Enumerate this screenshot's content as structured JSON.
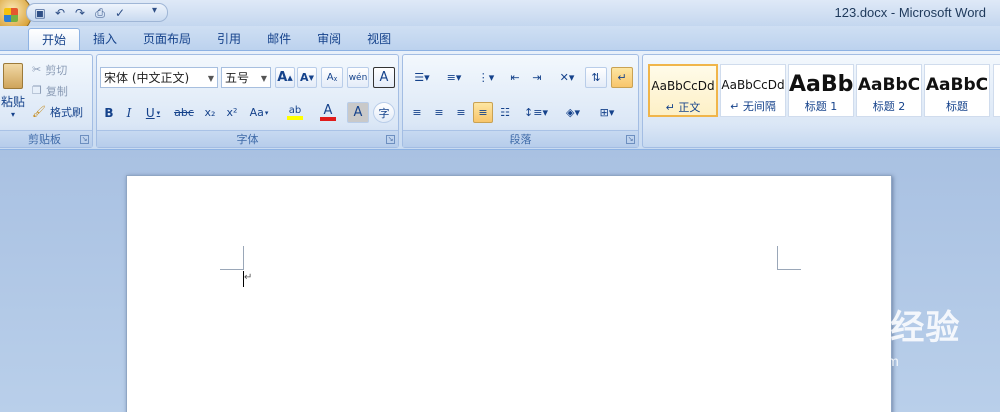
{
  "window": {
    "title": "123.docx - Microsoft Word"
  },
  "quick_access": {
    "icons": [
      "save-icon",
      "undo-icon",
      "redo-icon",
      "print-preview-icon",
      "spelling-icon"
    ]
  },
  "tabs": [
    {
      "label": "开始",
      "active": true
    },
    {
      "label": "插入"
    },
    {
      "label": "页面布局"
    },
    {
      "label": "引用"
    },
    {
      "label": "邮件"
    },
    {
      "label": "审阅"
    },
    {
      "label": "视图"
    }
  ],
  "clipboard": {
    "group_label": "剪贴板",
    "paste_label": "粘贴",
    "cut_label": "剪切",
    "copy_label": "复制",
    "format_painter_label": "格式刷"
  },
  "font": {
    "group_label": "字体",
    "font_name": "宋体 (中文正文)",
    "font_size": "五号",
    "grow_label": "A",
    "shrink_label": "A",
    "phonetic_label": "wén",
    "border_char_label": "A",
    "bold_label": "B",
    "italic_label": "I",
    "underline_label": "U",
    "strike_label": "abc",
    "subscript_label": "x₂",
    "superscript_label": "x²",
    "case_label": "Aa",
    "highlight_label": "ab",
    "font_color_label": "A",
    "char_shading_label": "A",
    "enclose_label": "字",
    "highlight_color": "#ffff00",
    "font_color": "#e01b1b"
  },
  "paragraph": {
    "group_label": "段落"
  },
  "styles": {
    "items": [
      {
        "sample": "AaBbCcDd",
        "name": "↵ 正文",
        "selected": true
      },
      {
        "sample": "AaBbCcDd",
        "name": "↵ 无间隔"
      },
      {
        "sample": "AaBb",
        "name": "标题 1"
      },
      {
        "sample": "AaBbC",
        "name": "标题 2"
      },
      {
        "sample": "AaBbC",
        "name": "标题"
      }
    ]
  },
  "watermark": {
    "main": "Bai du 经验",
    "sub": "jingyan.baidu.com"
  }
}
